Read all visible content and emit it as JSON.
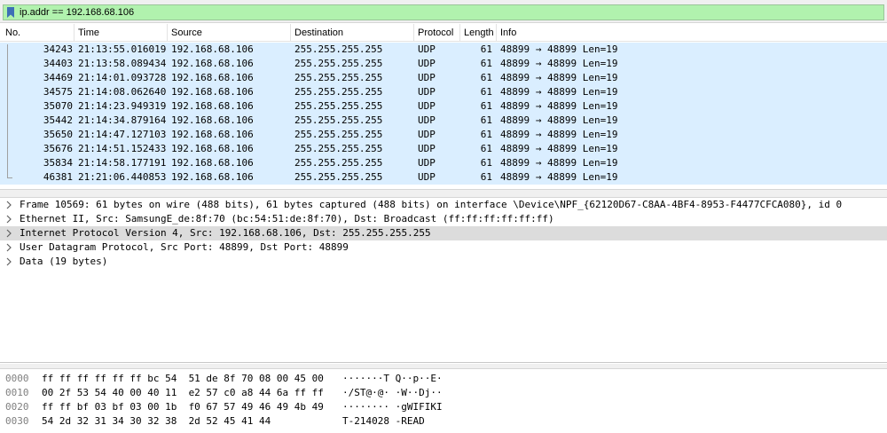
{
  "filter": {
    "text": "ip.addr == 192.168.68.106",
    "icon": "bookmark-icon"
  },
  "packet_list": {
    "columns": [
      "No.",
      "Time",
      "Source",
      "Destination",
      "Protocol",
      "Length",
      "Info"
    ],
    "rows": [
      {
        "no": "34243",
        "time": "21:13:55.016019",
        "source": "192.168.68.106",
        "destination": "255.255.255.255",
        "protocol": "UDP",
        "length": "61",
        "info": "48899 → 48899 Len=19"
      },
      {
        "no": "34403",
        "time": "21:13:58.089434",
        "source": "192.168.68.106",
        "destination": "255.255.255.255",
        "protocol": "UDP",
        "length": "61",
        "info": "48899 → 48899 Len=19"
      },
      {
        "no": "34469",
        "time": "21:14:01.093728",
        "source": "192.168.68.106",
        "destination": "255.255.255.255",
        "protocol": "UDP",
        "length": "61",
        "info": "48899 → 48899 Len=19"
      },
      {
        "no": "34575",
        "time": "21:14:08.062640",
        "source": "192.168.68.106",
        "destination": "255.255.255.255",
        "protocol": "UDP",
        "length": "61",
        "info": "48899 → 48899 Len=19"
      },
      {
        "no": "35070",
        "time": "21:14:23.949319",
        "source": "192.168.68.106",
        "destination": "255.255.255.255",
        "protocol": "UDP",
        "length": "61",
        "info": "48899 → 48899 Len=19"
      },
      {
        "no": "35442",
        "time": "21:14:34.879164",
        "source": "192.168.68.106",
        "destination": "255.255.255.255",
        "protocol": "UDP",
        "length": "61",
        "info": "48899 → 48899 Len=19"
      },
      {
        "no": "35650",
        "time": "21:14:47.127103",
        "source": "192.168.68.106",
        "destination": "255.255.255.255",
        "protocol": "UDP",
        "length": "61",
        "info": "48899 → 48899 Len=19"
      },
      {
        "no": "35676",
        "time": "21:14:51.152433",
        "source": "192.168.68.106",
        "destination": "255.255.255.255",
        "protocol": "UDP",
        "length": "61",
        "info": "48899 → 48899 Len=19"
      },
      {
        "no": "35834",
        "time": "21:14:58.177191",
        "source": "192.168.68.106",
        "destination": "255.255.255.255",
        "protocol": "UDP",
        "length": "61",
        "info": "48899 → 48899 Len=19"
      },
      {
        "no": "46381",
        "time": "21:21:06.440853",
        "source": "192.168.68.106",
        "destination": "255.255.255.255",
        "protocol": "UDP",
        "length": "61",
        "info": "48899 → 48899 Len=19"
      }
    ]
  },
  "details": {
    "items": [
      {
        "text": "Frame 10569: 61 bytes on wire (488 bits), 61 bytes captured (488 bits) on interface \\Device\\NPF_{62120D67-C8AA-4BF4-8953-F4477CFCA080}, id 0"
      },
      {
        "text": "Ethernet II, Src: SamsungE_de:8f:70 (bc:54:51:de:8f:70), Dst: Broadcast (ff:ff:ff:ff:ff:ff)"
      },
      {
        "text": "Internet Protocol Version 4, Src: 192.168.68.106, Dst: 255.255.255.255"
      },
      {
        "text": "User Datagram Protocol, Src Port: 48899, Dst Port: 48899"
      },
      {
        "text": "Data (19 bytes)"
      }
    ]
  },
  "hex": {
    "rows": [
      {
        "offset": "0000",
        "bytes": "ff ff ff ff ff ff bc 54  51 de 8f 70 08 00 45 00",
        "ascii": "·······T Q··p··E·"
      },
      {
        "offset": "0010",
        "bytes": "00 2f 53 54 40 00 40 11  e2 57 c0 a8 44 6a ff ff",
        "ascii": "·/ST@·@· ·W··Dj··"
      },
      {
        "offset": "0020",
        "bytes": "ff ff bf 03 bf 03 00 1b  f0 67 57 49 46 49 4b 49",
        "ascii": "········ ·gWIFIKI"
      },
      {
        "offset": "0030",
        "bytes": "54 2d 32 31 34 30 32 38  2d 52 45 41 44",
        "ascii": "T-214028 -READ"
      }
    ]
  },
  "colors": {
    "filter_bg": "#b1f2ae",
    "row_bg": "#daeeff",
    "selected_detail_bg": "#dcdcdc"
  }
}
